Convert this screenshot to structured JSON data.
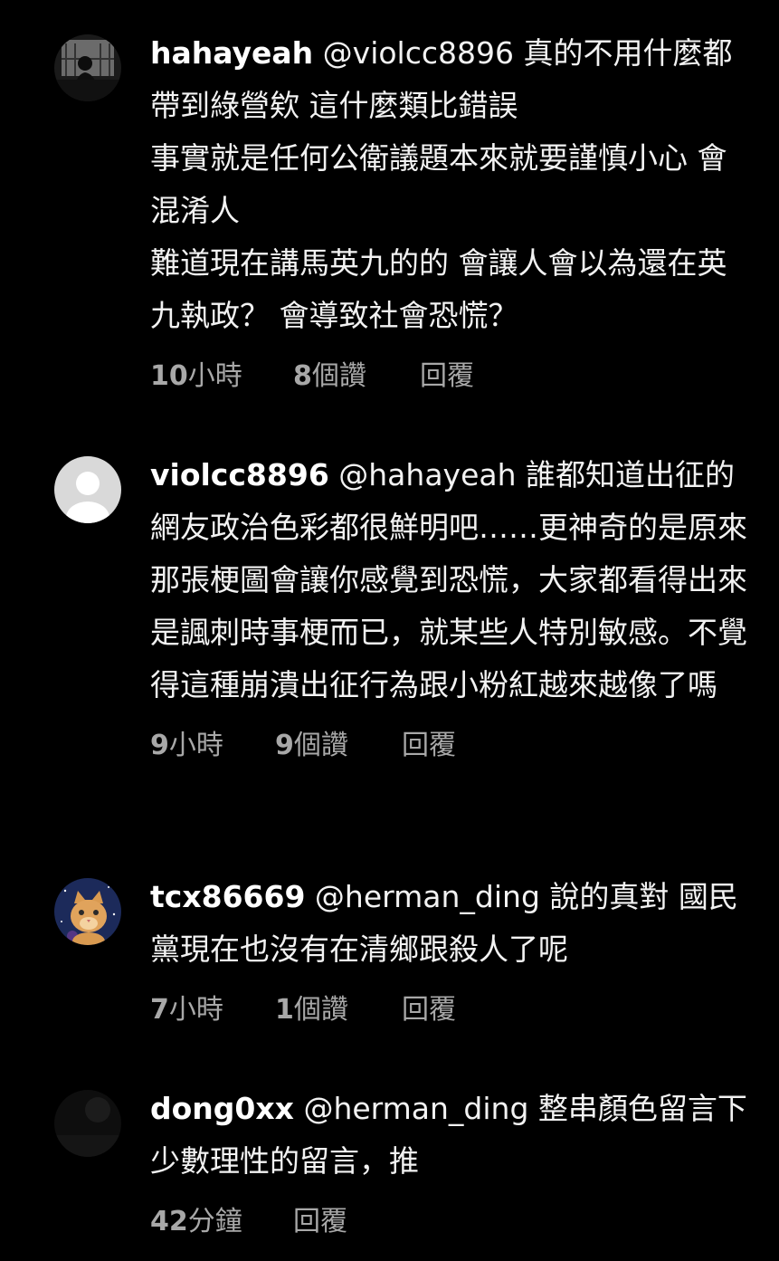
{
  "colors": {
    "background": "#000000",
    "text": "#f2f2f2",
    "meta": "#a8a8a8"
  },
  "comments": [
    {
      "username": "hahayeah",
      "text": " @violcc8896 真的不用什麼都帶到綠營欸 這什麼類比錯誤\n事實就是任何公衛議題本來就要謹慎小心 會混淆人\n難道現在講馬英九的的 會讓人會以為還在英九執政？ 會導致社會恐慌？",
      "time_num": "10",
      "time_unit": "小時",
      "likes_num": "8",
      "likes_unit": "個讚",
      "reply": "回覆",
      "avatar_icon": "silhouette-photo-avatar"
    },
    {
      "username": "violcc8896",
      "text": " @hahayeah 誰都知道出征的網友政治色彩都很鮮明吧……更神奇的是原來那張梗圖會讓你感覺到恐慌，大家都看得出來是諷刺時事梗而已，就某些人特別敏感。不覺得這種崩潰出征行為跟小粉紅越來越像了嗎",
      "time_num": "9",
      "time_unit": "小時",
      "likes_num": "9",
      "likes_unit": "個讚",
      "reply": "回覆",
      "avatar_icon": "default-user-avatar"
    },
    {
      "username": "tcx86669",
      "text": " @herman_ding 說的真對 國民黨現在也沒有在清鄉跟殺人了呢",
      "time_num": "7",
      "time_unit": "小時",
      "likes_num": "1",
      "likes_unit": "個讚",
      "reply": "回覆",
      "avatar_icon": "cat-in-space-avatar"
    },
    {
      "username": "dong0xx",
      "text": " @herman_ding 整串顏色留言下少數理性的留言，推",
      "time_num": "42",
      "time_unit": "分鐘",
      "likes_num": "",
      "likes_unit": "",
      "reply": "回覆",
      "avatar_icon": "dark-photo-avatar"
    }
  ]
}
